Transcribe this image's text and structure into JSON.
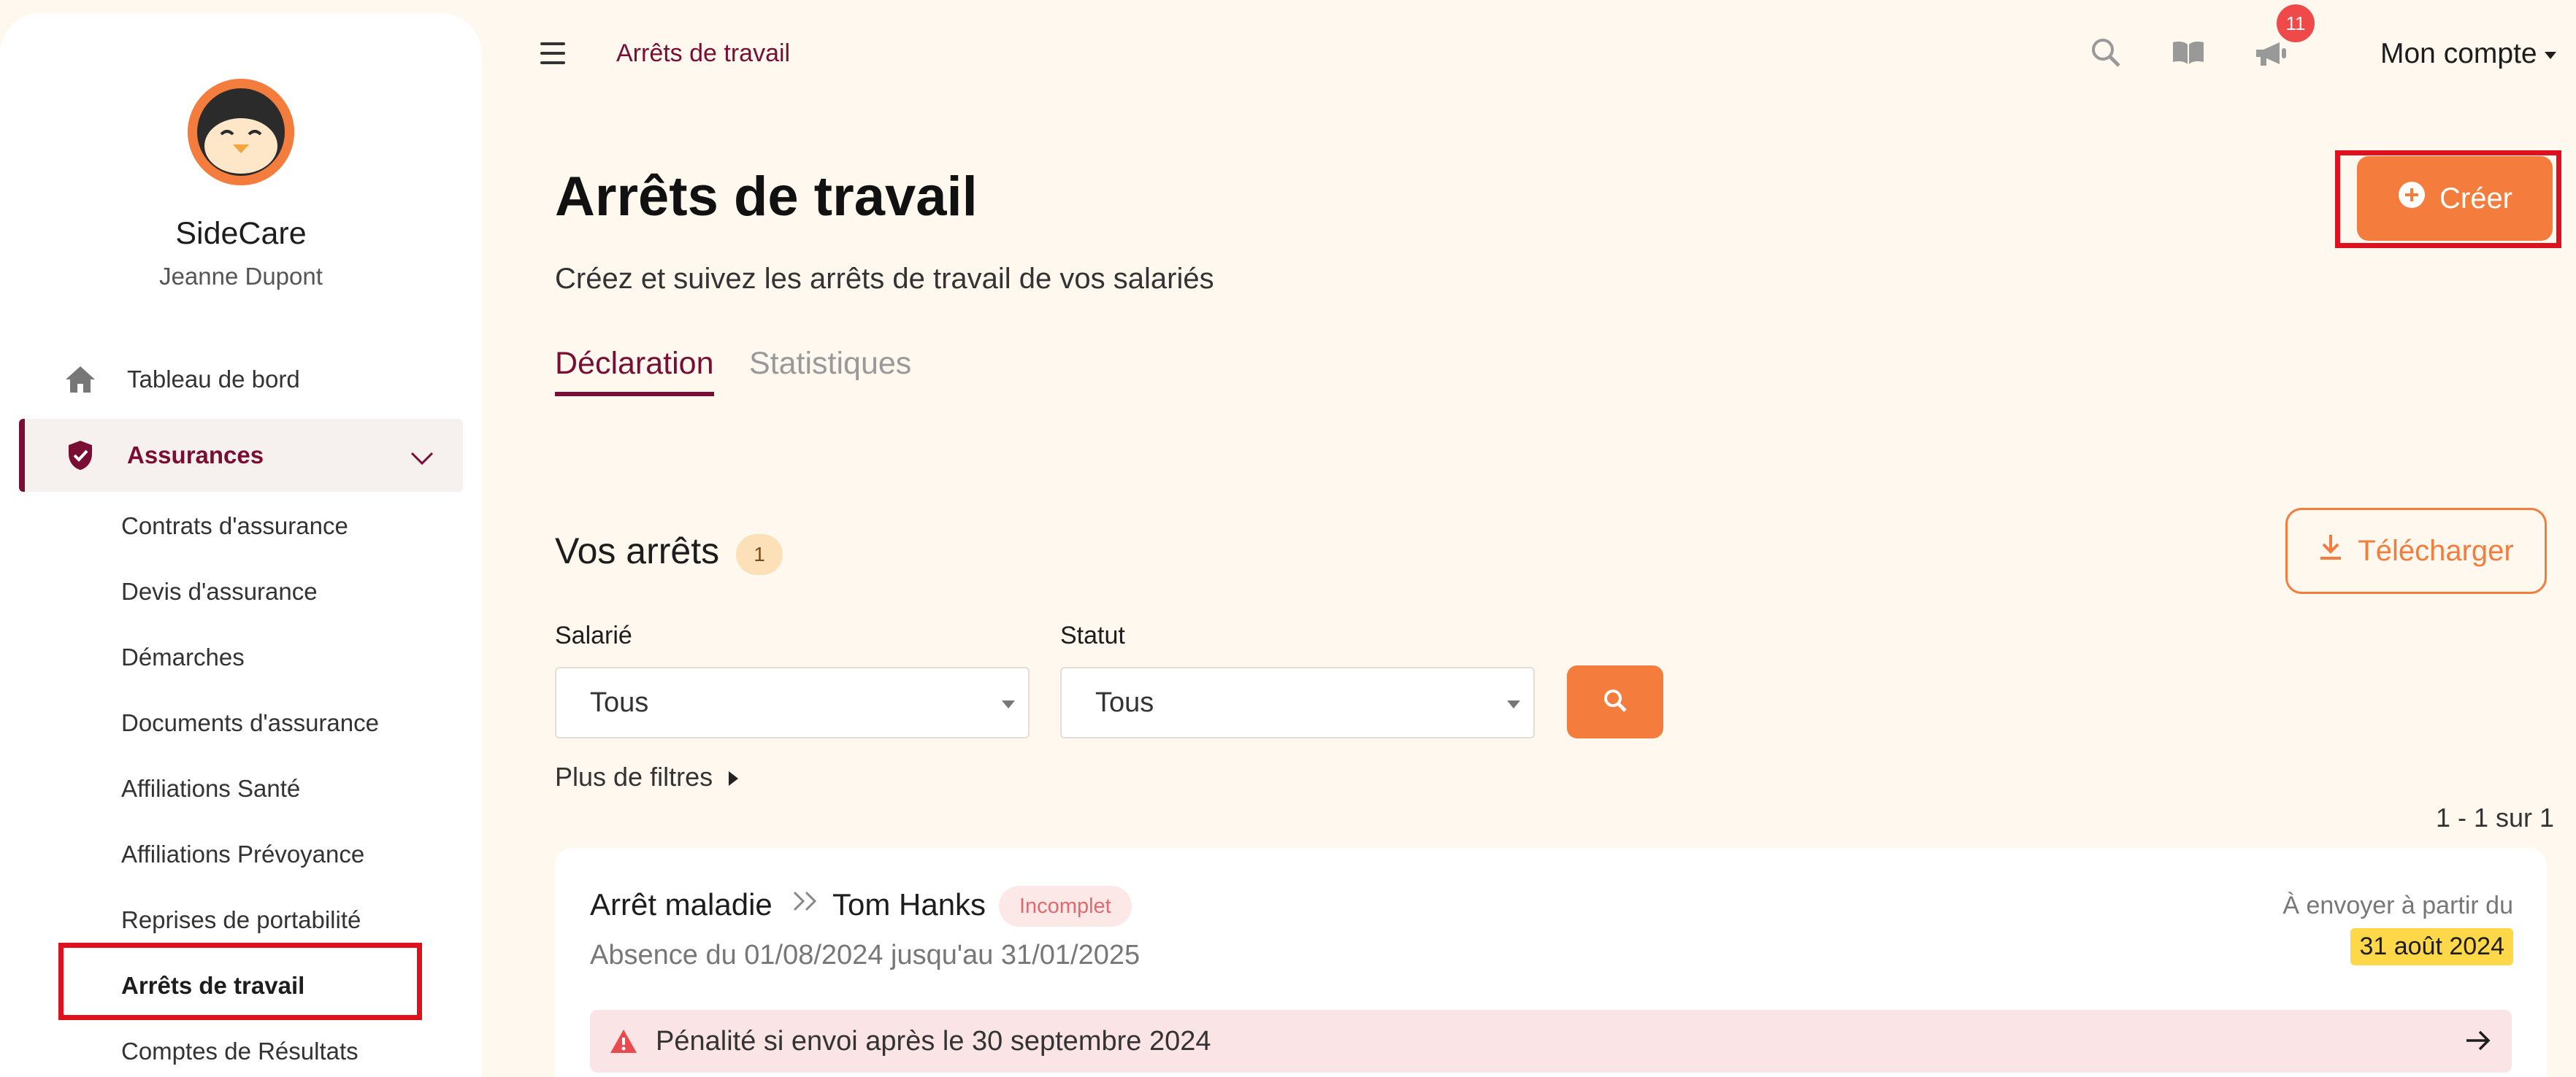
{
  "sidebar": {
    "brand": "SideCare",
    "user": "Jeanne Dupont",
    "nav": [
      {
        "label": "Tableau de bord",
        "icon": "home-icon"
      },
      {
        "label": "Assurances",
        "icon": "shield-check-icon",
        "active": true
      }
    ],
    "sub_items": [
      {
        "label": "Contrats d'assurance"
      },
      {
        "label": "Devis d'assurance"
      },
      {
        "label": "Démarches"
      },
      {
        "label": "Documents d'assurance"
      },
      {
        "label": "Affiliations Santé"
      },
      {
        "label": "Affiliations Prévoyance"
      },
      {
        "label": "Reprises de portabilité"
      },
      {
        "label": "Arrêts de travail",
        "selected": true
      },
      {
        "label": "Comptes de Résultats"
      }
    ]
  },
  "topbar": {
    "breadcrumb": "Arrêts de travail",
    "notifications_count": "11",
    "account": "Mon compte",
    "icons": [
      "menu-icon",
      "search-icon",
      "book-icon",
      "megaphone-icon"
    ]
  },
  "main": {
    "title": "Arrêts de travail",
    "subtitle": "Créez et suivez les arrêts de travail de vos salariés",
    "create_label": "Créer",
    "tabs": [
      {
        "label": "Déclaration",
        "active": true
      },
      {
        "label": "Statistiques",
        "active": false
      }
    ],
    "list_title": "Vos arrêts",
    "list_count": "1",
    "download_label": "Télécharger",
    "filters": {
      "employee_label": "Salarié",
      "employee_value": "Tous",
      "status_label": "Statut",
      "status_value": "Tous",
      "more_filters": "Plus de filtres"
    },
    "pagination": "1 - 1 sur 1",
    "records": [
      {
        "type": "Arrêt maladie",
        "employee": "Tom Hanks",
        "status": "Incomplet",
        "period": "Absence du 01/08/2024 jusqu'au 31/01/2025",
        "send_from_label": "À envoyer à partir du",
        "send_from_date": "31 août 2024",
        "penalty": "Pénalité si envoi après le 30 septembre 2024"
      }
    ]
  },
  "colors": {
    "accent": "#f47c3c",
    "brand_dark": "#7a0d33",
    "background": "#fff8ef",
    "highlight": "#e0111f"
  }
}
